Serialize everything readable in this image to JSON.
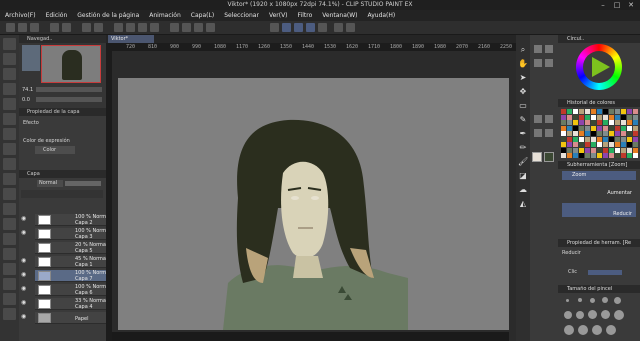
{
  "window": {
    "title": "Viktor* (1920 x 1080px 72dpi 74.1%) - CLIP STUDIO PAINT EX"
  },
  "menubar": {
    "items": [
      "Archivo(F)",
      "Edición",
      "Gestión de la página",
      "Animación",
      "Capa(L)",
      "Seleccionar",
      "Ver(V)",
      "Filtro",
      "Ventana(W)",
      "Ayuda(H)"
    ]
  },
  "canvas": {
    "tab_label": "Viktor*",
    "ruler_numbers": [
      "720",
      "810",
      "900",
      "990",
      "1080",
      "1170",
      "1260",
      "1350",
      "1440",
      "1530",
      "1620",
      "1710",
      "1800",
      "1890",
      "1980",
      "2070",
      "2160",
      "2250"
    ]
  },
  "navigator": {
    "title": "Navegad..",
    "zoom_value": "74.1",
    "angle_value": "0.0"
  },
  "layer_properties": {
    "title": "Propiedad de la capa",
    "effect_label": "Efecto",
    "expression_label": "Color de expresión",
    "expression_value": "Color"
  },
  "layers": {
    "title": "Capa",
    "blend_mode": "Normal",
    "rows": [
      {
        "opacity": "100 % Normal",
        "name": "Capa 2"
      },
      {
        "opacity": "100 % Normal",
        "name": "Capa 3"
      },
      {
        "opacity": "20 % Normal",
        "name": "Capa 5"
      },
      {
        "opacity": "45 % Normal",
        "name": "Capa 1"
      },
      {
        "opacity": "100 % Normal",
        "name": "Capa 7"
      },
      {
        "opacity": "100 % Normal",
        "name": "Capa 6"
      },
      {
        "opacity": "33 % Normal",
        "name": "Capa 4"
      },
      {
        "opacity": "",
        "name": "Papel"
      }
    ]
  },
  "right": {
    "color_panel_title": "Círcul..",
    "history_title": "Historial de colores",
    "subtool_title": "Subherramienta [Zoom]",
    "subtool_group": "Zoom",
    "subtool_options": [
      "Aumentar",
      "Reducir"
    ],
    "toolprop_title": "Propiedad de herram. [Re",
    "toolprop_name": "Reducir",
    "toolprop_row": "Clic",
    "brush_title": "Tamaño del pincel"
  },
  "colors": {
    "accent": "#4c5c80",
    "canvas_bg": "#808080",
    "paper_green": "#6a7a63",
    "hair": "#2b2e1e"
  }
}
